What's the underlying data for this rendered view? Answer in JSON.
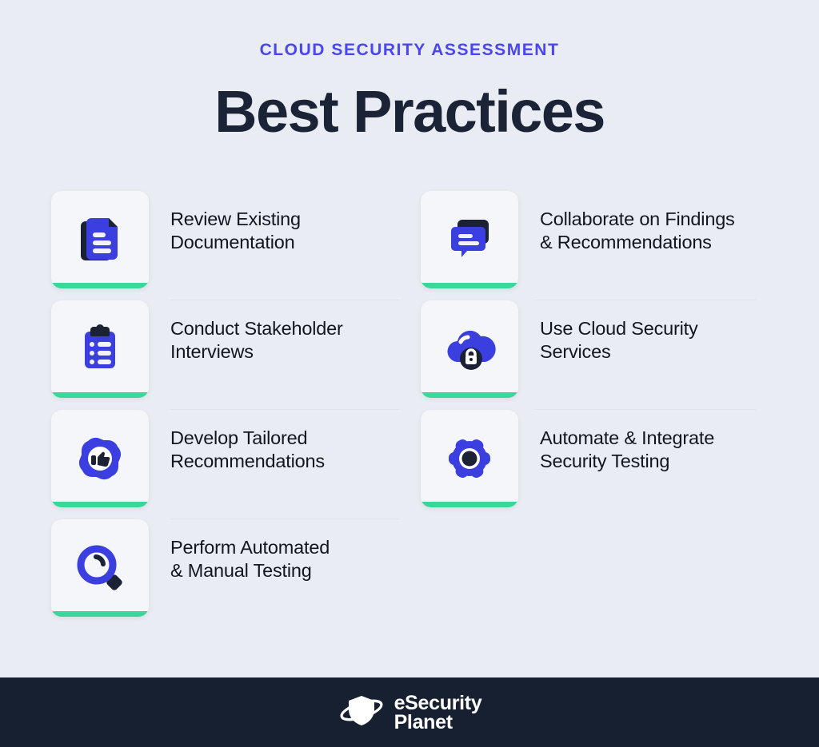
{
  "header": {
    "eyebrow": "CLOUD SECURITY ASSESSMENT",
    "title": "Best Practices"
  },
  "colors": {
    "background": "#e9ecf2",
    "card_background": "#f5f6fa",
    "accent_green": "#3bd69a",
    "brand_blue": "#3b3fe0",
    "eyebrow_blue": "#4a46f0",
    "navy": "#1a2234",
    "footer_background": "#172030",
    "text": "#12161f",
    "divider": "#dfe3ea"
  },
  "items": {
    "left": [
      {
        "icon": "documents-icon",
        "label_line1": "Review Existing",
        "label_line2": "Documentation"
      },
      {
        "icon": "clipboard-list-icon",
        "label_line1": "Conduct Stakeholder",
        "label_line2": "Interviews"
      },
      {
        "icon": "badge-thumbs-up-icon",
        "label_line1": "Develop Tailored",
        "label_line2": "Recommendations"
      },
      {
        "icon": "magnifier-icon",
        "label_line1": "Perform Automated",
        "label_line2": "& Manual Testing"
      }
    ],
    "right": [
      {
        "icon": "chat-bubbles-icon",
        "label_line1": "Collaborate on Findings",
        "label_line2": "& Recommendations"
      },
      {
        "icon": "cloud-lock-icon",
        "label_line1": "Use Cloud Security",
        "label_line2": "Services"
      },
      {
        "icon": "gear-icon",
        "label_line1": "Automate & Integrate",
        "label_line2": "Security Testing"
      }
    ]
  },
  "footer": {
    "logo_icon": "shield-planet-icon",
    "logo_line1": "eSecurity",
    "logo_line2": "Planet"
  }
}
